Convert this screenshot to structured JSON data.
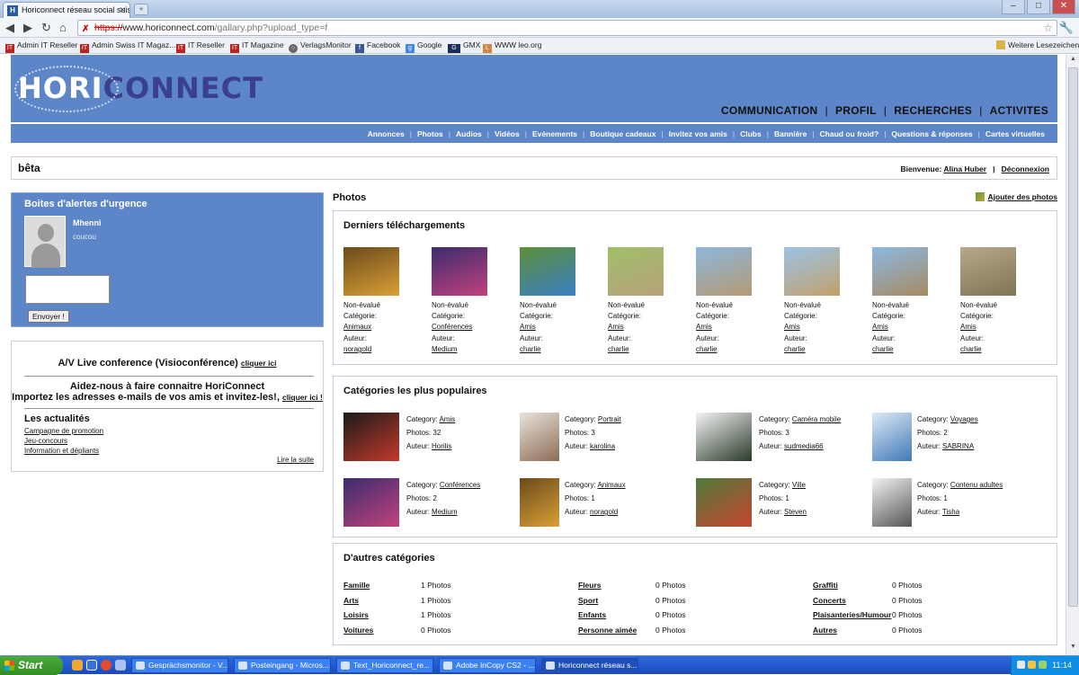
{
  "browser": {
    "tab_title": "Horiconnect réseau social suis",
    "url_scheme": "https://",
    "url_host": "www.horiconnect.com",
    "url_path": "/gallary.php?upload_type=f",
    "bookmarks": [
      "Admin IT Reseller",
      "Admin Swiss IT Magaz...",
      "IT Reseller",
      "IT Magazine",
      "VerlagsMonitor",
      "Facebook",
      "Google",
      "GMX",
      "WWW leo.org"
    ],
    "other_bookmarks": "Weitere Lesezeichen"
  },
  "site": {
    "logo_a": "HORI",
    "logo_b": "CONNECT",
    "main_nav": [
      "COMMUNICATION",
      "PROFIL",
      "RECHERCHES",
      "ACTIVITES"
    ],
    "sub_nav": [
      "Annonces",
      "Photos",
      "Audios",
      "Vidéos",
      "Evénements",
      "Boutique cadeaux",
      "Invitez vos amis",
      "Clubs",
      "Bannière",
      "Chaud ou froid?",
      "Questions & réponses",
      "Cartes virtuelles"
    ],
    "beta": "bêta",
    "welcome_label": "Bienvenue:",
    "user_name": "Alina Huber",
    "logout": "Déconnexion"
  },
  "alerts": {
    "title": "Boites d'alertes d'urgence",
    "user": "Mhenni",
    "message": "coucou",
    "send_button": "Envoyer !"
  },
  "info": {
    "av_text": "A/V Live conference (Visioconférence)",
    "av_link": "cliquer ici",
    "help_line1": "Aidez-nous à faire connaitre HoriConnect",
    "help_line2": "Importez les adresses e-mails de vos amis et invitez-les!,",
    "help_link": "cliquer ici !",
    "news_title": "Les actualités",
    "news_links": [
      "Campagne de promotion",
      "Jeu-concours",
      "Information et dépliants"
    ],
    "more": "Lire la suite"
  },
  "photos": {
    "title": "Photos",
    "add_link": "Ajouter des photos",
    "recent_title": "Derniers téléchargements",
    "status_label": "Non-évalué",
    "category_label": "Catégorie:",
    "author_label": "Auteur:",
    "recent": [
      {
        "category": "Animaux",
        "author": "noragold",
        "c1": "#6b4a1c",
        "c2": "#d9a035"
      },
      {
        "category": "Conférences",
        "author": "Medium",
        "c1": "#3b2c6e",
        "c2": "#c2427c"
      },
      {
        "category": "Amis",
        "author": "charlie",
        "c1": "#5c8f3a",
        "c2": "#3b7fc4"
      },
      {
        "category": "Amis",
        "author": "charlie",
        "c1": "#9fbf6a",
        "c2": "#b8a27a"
      },
      {
        "category": "Amis",
        "author": "charlie",
        "c1": "#8db7de",
        "c2": "#b59a72"
      },
      {
        "category": "Amis",
        "author": "charlie",
        "c1": "#9cc3e6",
        "c2": "#c2a06c"
      },
      {
        "category": "Amis",
        "author": "charlie",
        "c1": "#8cb8e2",
        "c2": "#a88a62"
      },
      {
        "category": "Amis",
        "author": "charlie",
        "c1": "#b7a888",
        "c2": "#7f7455"
      }
    ],
    "popular_title": "Catégories les plus populaires",
    "cat_label": "Category:",
    "photos_label": "Photos:",
    "author_label2": "Auteur:",
    "popular": [
      {
        "category": "Amis",
        "count": "32",
        "author": "Horilis",
        "c1": "#1a1a1a",
        "c2": "#c33a2a"
      },
      {
        "category": "Portrait",
        "count": "3",
        "author": "karolina",
        "c1": "#e8e3dc",
        "c2": "#8d6c55"
      },
      {
        "category": "Caméra mobile",
        "count": "3",
        "author": "sudmedia66",
        "c1": "#f4f4f4",
        "c2": "#2a3a2a"
      },
      {
        "category": "Voyages",
        "count": "2",
        "author": "SABRINA",
        "c1": "#dfeaf6",
        "c2": "#3f79b8"
      },
      {
        "category": "Conférences",
        "count": "2",
        "author": "Medium",
        "c1": "#3b2c6e",
        "c2": "#c2427c"
      },
      {
        "category": "Animaux",
        "count": "1",
        "author": "noragold",
        "c1": "#6b4a1c",
        "c2": "#d9a035"
      },
      {
        "category": "Ville",
        "count": "1",
        "author": "Steven",
        "c1": "#4f7a3c",
        "c2": "#c7452d"
      },
      {
        "category": "Contenu adultes",
        "count": "1",
        "author": "Tisha",
        "c1": "#f3f3f3",
        "c2": "#555555"
      }
    ],
    "others_title": "D'autres catégories",
    "others": [
      {
        "name": "Famille",
        "count": "1 Photos"
      },
      {
        "name": "Arts",
        "count": "1 Photos"
      },
      {
        "name": "Loisirs",
        "count": "1 Photos"
      },
      {
        "name": "Voitures",
        "count": "0 Photos"
      },
      {
        "name": "Fleurs",
        "count": "0 Photos"
      },
      {
        "name": "Sport",
        "count": "0 Photos"
      },
      {
        "name": "Enfants",
        "count": "0 Photos"
      },
      {
        "name": "Personne aimée",
        "count": "0 Photos"
      },
      {
        "name": "Graffiti",
        "count": "0 Photos"
      },
      {
        "name": "Concerts",
        "count": "0 Photos"
      },
      {
        "name": "Plaisanteries/Humour",
        "count": "0 Photos"
      },
      {
        "name": "Autres",
        "count": "0 Photos"
      }
    ]
  },
  "taskbar": {
    "start": "Start",
    "items": [
      "Gesprächsmonitor - V...",
      "Posteingang - Micros...",
      "Text_Horiconnect_re...",
      "Adobe InCopy CS2 - ...",
      "Horiconnect réseau s..."
    ],
    "time": "11:14"
  }
}
